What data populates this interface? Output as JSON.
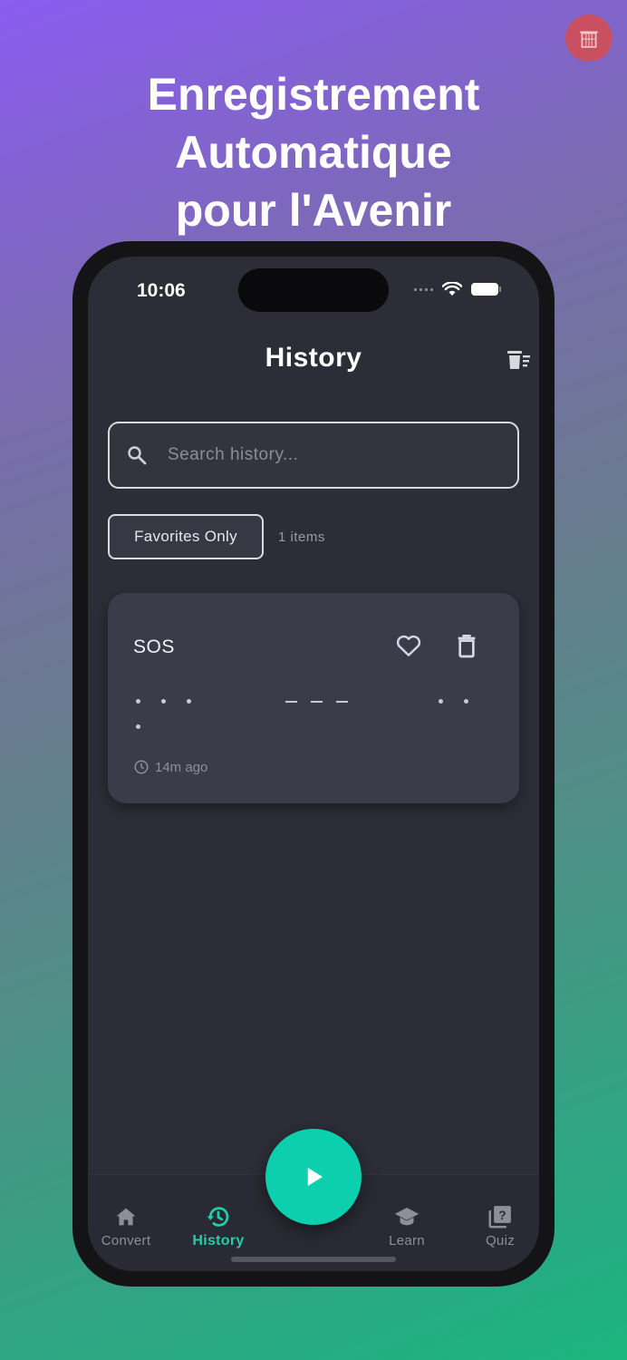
{
  "promo": {
    "line1": "Enregistrement",
    "line2": "Automatique",
    "line3": "pour l'Avenir"
  },
  "status_bar": {
    "time": "10:06"
  },
  "header": {
    "title": "History",
    "action_icon": "clear-all-icon"
  },
  "search": {
    "placeholder": "Search history...",
    "value": ""
  },
  "filter": {
    "favorites_label": "Favorites Only",
    "count_text": "1 items"
  },
  "history": [
    {
      "title": "SOS",
      "morse": "... --- ...",
      "time_ago": "14m ago"
    }
  ],
  "nav": {
    "items": [
      {
        "label": "Convert",
        "icon": "home-icon"
      },
      {
        "label": "History",
        "icon": "history-icon",
        "active": true
      },
      {
        "label": "Learn",
        "icon": "graduation-cap-icon"
      },
      {
        "label": "Quiz",
        "icon": "quiz-icon"
      }
    ],
    "fab_icon": "play-icon"
  },
  "colors": {
    "accent": "#0ccfad",
    "screen_bg": "#2d2d38",
    "card_bg": "#3b3b4a",
    "badge": "#c85060"
  }
}
